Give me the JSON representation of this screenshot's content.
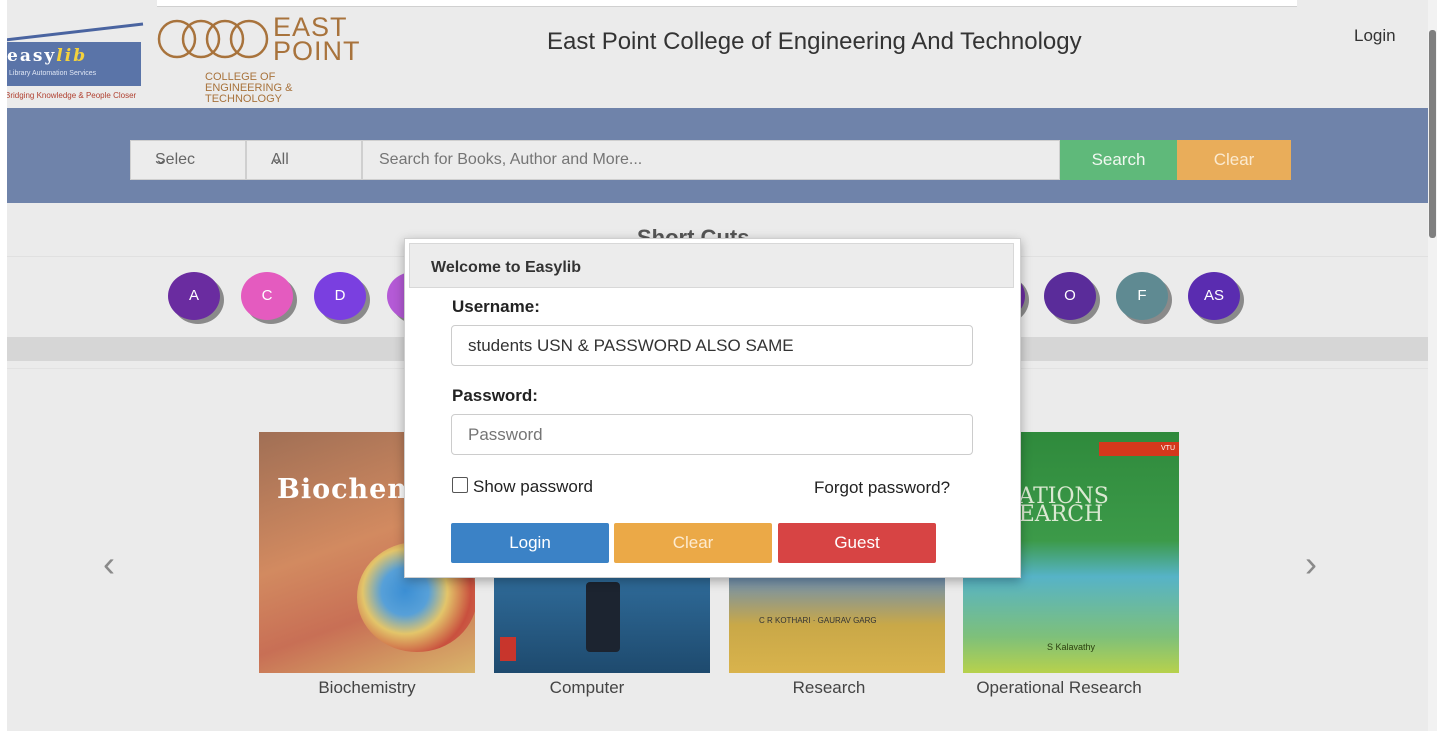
{
  "header": {
    "easylib_logo_word": "easylib",
    "easylib_logo_sub": "Library Automation Services",
    "easylib_logo_tagline": "Bridging Knowledge & People Closer",
    "ep_logo_east": "EAST",
    "ep_logo_point": "POINT",
    "ep_logo_college_lines": [
      "COLLEGE OF",
      "ENGINEERING &",
      "TECHNOLOGY"
    ],
    "college_name": "East Point College of Engineering And Technology",
    "login_link": "Login"
  },
  "search": {
    "select_type_value": "Selec",
    "select_field_value": "All",
    "placeholder": "Search for Books, Author and More...",
    "search_label": "Search",
    "clear_label": "Clear"
  },
  "shortcuts": {
    "title": "Short Cuts",
    "items": [
      {
        "label": "A",
        "color": "#6a2ca0"
      },
      {
        "label": "C",
        "color": "#e45bbf"
      },
      {
        "label": "D",
        "color": "#7a3fe0"
      },
      {
        "label": "",
        "color": "#b45ad6"
      },
      {
        "label": "",
        "color": "#6a2ca0"
      },
      {
        "label": "O",
        "color": "#5a2c9a"
      },
      {
        "label": "F",
        "color": "#5f8a92"
      },
      {
        "label": "AS",
        "color": "#5a2cb0"
      }
    ]
  },
  "books": [
    {
      "title": "Biochemistry",
      "cover_text": "Biochemis"
    },
    {
      "title": "Computer",
      "cover_text": ""
    },
    {
      "title": "Research",
      "cover_text": "C R KOTHARI · GAURAV GARG"
    },
    {
      "title": "Operational Research",
      "cover_text": "PERATIONS RESEARCH",
      "badge": "VTU",
      "author": "S Kalavathy"
    }
  ],
  "modal": {
    "title": "Welcome to Easylib",
    "username_label": "Username:",
    "username_value": "students USN & PASSWORD ALSO SAME",
    "password_label": "Password:",
    "password_placeholder": "Password",
    "show_password_label": "Show password",
    "forgot_password": "Forgot password?",
    "login_label": "Login",
    "clear_label": "Clear",
    "guest_label": "Guest"
  }
}
